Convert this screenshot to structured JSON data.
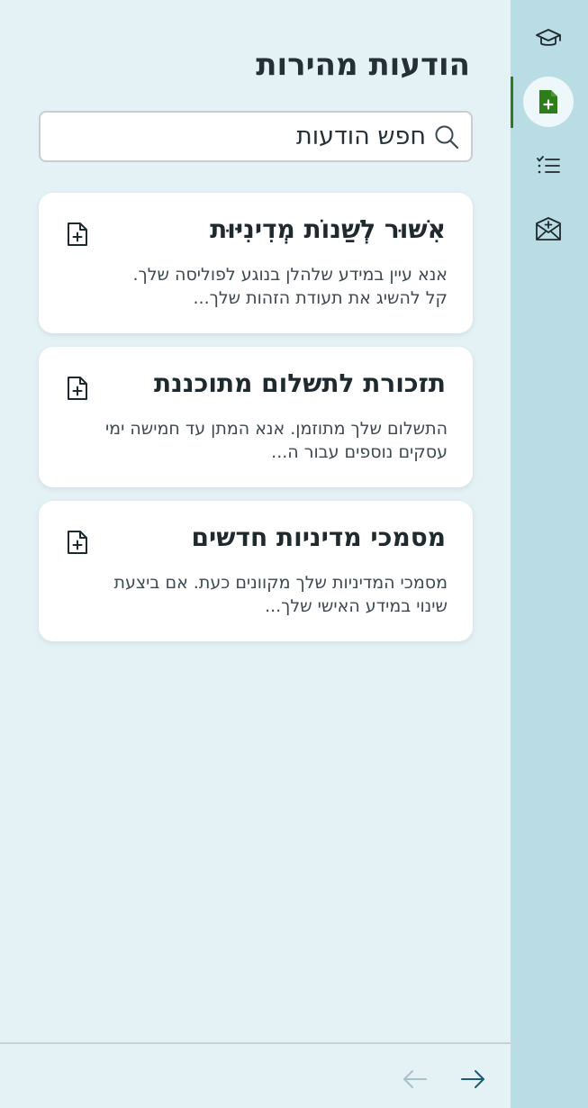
{
  "header": {
    "title": "הודעות מהירות"
  },
  "search": {
    "placeholder": "חפש הודעות",
    "value": ""
  },
  "messages": [
    {
      "title": "אִשּׁוּר לְשַׁנוֹת מְדִינִיּוּת",
      "preview_line1": "אנא עיין במידע שלהלן בנוגע לפוליסה שלך.",
      "preview_line2": "קל להשיג את תעודת הזהות שלך...",
      "icon": "file-plus-icon"
    },
    {
      "title": "תזכורת לתשלום מתוכננת",
      "preview_line1": "התשלום שלך מתוזמן. אנא המתן עד חמישה ימי",
      "preview_line2": "עסקים נוספים עבור ה...",
      "icon": "file-plus-icon"
    },
    {
      "title": "מסמכי מדיניות חדשים",
      "preview_line1": "מסמכי המדיניות שלך מקוונים כעת. אם ביצעת",
      "preview_line2": "שינוי במידע האישי שלך...",
      "icon": "file-plus-icon"
    }
  ],
  "sidebar": {
    "items": [
      {
        "icon": "graduation-cap-icon",
        "active": false
      },
      {
        "icon": "file-plus-icon",
        "active": true
      },
      {
        "icon": "checklist-icon",
        "active": false
      },
      {
        "icon": "mail-plus-icon",
        "active": false
      }
    ]
  },
  "footer": {
    "back_icon": "arrow-left-icon",
    "forward_icon": "arrow-right-icon"
  },
  "colors": {
    "background": "#e4f1f5",
    "sidebar": "#b9dce5",
    "accent": "#2e7d1b",
    "nav_arrow_enabled": "#1d5a74",
    "nav_arrow_disabled": "#a9c2c8"
  }
}
